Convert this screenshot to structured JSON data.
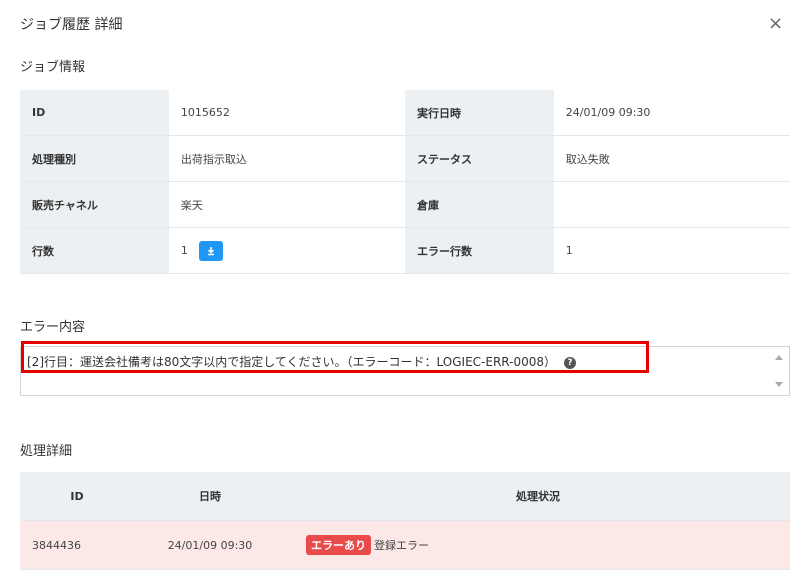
{
  "dialog": {
    "title": "ジョブ履歴 詳細",
    "close_symbol": "×"
  },
  "job_info": {
    "heading": "ジョブ情報",
    "rows": [
      {
        "label1": "ID",
        "value1": "1015652",
        "label2": "実行日時",
        "value2": "24/01/09 09:30"
      },
      {
        "label1": "処理種別",
        "value1": "出荷指示取込",
        "label2": "ステータス",
        "value2": "取込失敗"
      },
      {
        "label1": "販売チャネル",
        "value1": "楽天",
        "label2": "倉庫",
        "value2": ""
      },
      {
        "label1": "行数",
        "value1": "1",
        "label2": "エラー行数",
        "value2": "1"
      }
    ],
    "download_icon": "download-icon"
  },
  "error": {
    "heading": "エラー内容",
    "message": "[2]行目：運送会社備考は80文字以内で指定してください。（エラーコード：LOGIEC-ERR-0008）",
    "help_symbol": "?"
  },
  "detail": {
    "heading": "処理詳細",
    "columns": [
      "ID",
      "日時",
      "処理状況"
    ],
    "rows": [
      {
        "id": "3844436",
        "datetime": "24/01/09 09:30",
        "badge": "エラーあり",
        "status": "登録エラー"
      }
    ],
    "colors": {
      "error_row_bg": "#fde8e8",
      "badge_bg": "#e94a4a"
    }
  }
}
